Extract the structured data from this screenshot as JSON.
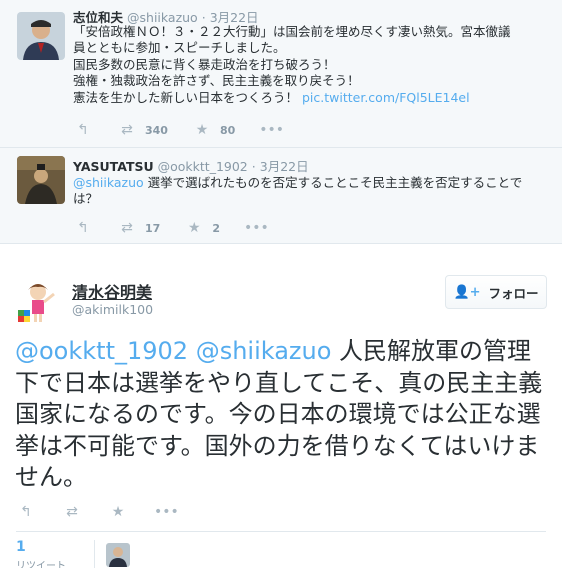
{
  "tweets": [
    {
      "name": "志位和夫",
      "handle": "@shiikazuo",
      "sep": "·",
      "date": "3月22日",
      "lines": [
        "「安倍政権ＮＯ！３・２２大行動」は国会前を埋め尽くす凄い熱気。宮本徹議",
        "員とともに参加・スピーチしました。",
        "国民多数の民意に背く暴走政治を打ち破ろう！",
        "強権・独裁政治を許さず、民主主義を取り戻そう！",
        "憲法を生かした新しい日本をつくろう！ "
      ],
      "link": "pic.twitter.com/FQl5LE14el",
      "retweets": "340",
      "favorites": "80"
    },
    {
      "name": "YASUTATSU",
      "handle": "@ookktt_1902",
      "sep": "·",
      "date": "3月22日",
      "mention": "@shiikazuo",
      "line1": " 選挙で選ばれたものを否定することこそ民主主義を否定することで",
      "line2": "は？",
      "retweets": "17",
      "favorites": "2"
    }
  ],
  "main": {
    "name": "清水谷明美",
    "handle": "@akimilk100",
    "follow_label": "フォロー",
    "mentions": "@ookktt_1902 @shiikazuo",
    "text": " 人民解放軍の管理下で日本は選挙をやり直してこそ、真の民主主義国家になるのです。今の日本の環境では公正な選挙は不可能です。国外の力を借りなくてはいけません。",
    "retweet_count": "1",
    "retweet_label": "リツイート"
  },
  "icons": {
    "reply": "reply-icon",
    "retweet": "retweet-icon",
    "favorite": "star-icon",
    "more": "more-icon",
    "follow": "add-user-icon"
  },
  "colors": {
    "link": "#55acee",
    "muted": "#8899a6",
    "text": "#292f33",
    "stream_bg": "#f5f8fa"
  }
}
